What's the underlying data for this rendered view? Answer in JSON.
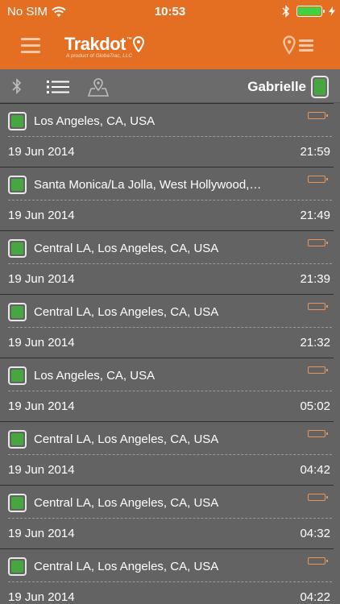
{
  "status_bar": {
    "carrier": "No SIM",
    "time": "10:53",
    "battery_level": 1.0
  },
  "header": {
    "brand": "Trakdot",
    "tm": "™",
    "tagline": "A product of GlobaTrac, LLC",
    "accent_color": "#e46f22"
  },
  "toolbar": {
    "user_name": "Gabrielle"
  },
  "trips": [
    {
      "location": "Los Angeles, CA, USA",
      "date": "19 Jun 2014",
      "time": "21:59"
    },
    {
      "location": "Santa Monica/La Jolla, West Hollywood,…",
      "date": "19 Jun 2014",
      "time": "21:49"
    },
    {
      "location": "Central LA, Los Angeles, CA, USA",
      "date": "19 Jun 2014",
      "time": "21:39"
    },
    {
      "location": "Central LA, Los Angeles, CA, USA",
      "date": "19 Jun 2014",
      "time": "21:32"
    },
    {
      "location": "Los Angeles, CA, USA",
      "date": "19 Jun 2014",
      "time": "05:02"
    },
    {
      "location": "Central LA, Los Angeles, CA, USA",
      "date": "19 Jun 2014",
      "time": "04:42"
    },
    {
      "location": "Central LA, Los Angeles, CA, USA",
      "date": "19 Jun 2014",
      "time": "04:32"
    },
    {
      "location": "Central LA, Los Angeles, CA, USA",
      "date": "19 Jun 2014",
      "time": "04:22"
    }
  ],
  "icons": {
    "wifi": "wifi-icon",
    "bluetooth": "bluetooth-icon",
    "battery": "battery-icon",
    "menu": "hamburger-menu-icon",
    "pin": "location-pin-icon",
    "list": "list-icon",
    "map": "map-pin-icon"
  }
}
